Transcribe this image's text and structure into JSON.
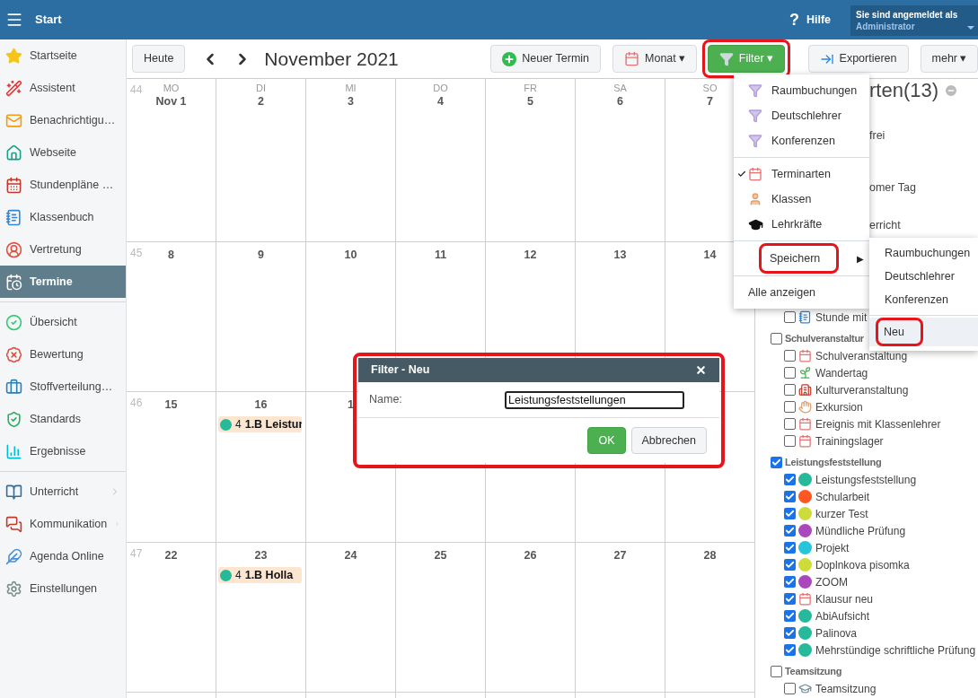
{
  "header": {
    "title": "Start",
    "help_icon": "?",
    "help": "Hilfe",
    "user": {
      "caption": "Sie sind angemeldet als",
      "name": "Administrator"
    }
  },
  "sidebar": {
    "groups": [
      [
        {
          "label": "Startseite",
          "selected": false
        },
        {
          "label": "Assistent",
          "selected": false
        },
        {
          "label": "Benachrichtigu…",
          "selected": false
        },
        {
          "label": "Webseite",
          "selected": false
        },
        {
          "label": "Stundenpläne …",
          "selected": false
        },
        {
          "label": "Klassenbuch",
          "selected": false
        },
        {
          "label": "Vertretung",
          "selected": false
        },
        {
          "label": "Termine",
          "selected": true
        }
      ],
      [
        {
          "label": "Übersicht",
          "selected": false
        },
        {
          "label": "Bewertung",
          "selected": false
        },
        {
          "label": "Stoffverteilung…",
          "selected": false
        },
        {
          "label": "Standards",
          "selected": false
        },
        {
          "label": "Ergebnisse",
          "selected": false
        }
      ],
      [
        {
          "label": "Unterricht",
          "selected": false,
          "has_submenu": true
        },
        {
          "label": "Kommunikation",
          "selected": false,
          "has_submenu": true
        },
        {
          "label": "Agenda Online",
          "selected": false
        },
        {
          "label": "Einstellungen",
          "selected": false
        }
      ]
    ]
  },
  "toolbar": {
    "today": "Heute",
    "title": "November 2021",
    "buttons": [
      {
        "label": "Neuer Termin",
        "kind": "add"
      },
      {
        "label": "Monat",
        "kind": "view",
        "caret": "▾"
      },
      {
        "label": "Filter",
        "kind": "filter",
        "caret": "▾",
        "marked": true
      },
      {
        "label": "Exportieren",
        "kind": "export"
      },
      {
        "label": "mehr",
        "kind": "more",
        "caret": "▾"
      }
    ]
  },
  "calendar": {
    "day_names": [
      "MO",
      "DI",
      "MI",
      "DO",
      "FR",
      "SA",
      "SO"
    ],
    "weeks": [
      {
        "number": "44",
        "days": [
          {
            "date": "Nov 1"
          },
          {
            "date": "2"
          },
          {
            "date": "3"
          },
          {
            "date": "4"
          },
          {
            "date": "5"
          },
          {
            "date": "6"
          },
          {
            "date": "7"
          }
        ]
      },
      {
        "number": "45",
        "days": [
          {
            "date": "8"
          },
          {
            "date": "9"
          },
          {
            "date": "10"
          },
          {
            "date": "11"
          },
          {
            "date": "12"
          },
          {
            "date": "13"
          },
          {
            "date": "14"
          }
        ]
      },
      {
        "number": "46",
        "days": [
          {
            "date": "15"
          },
          {
            "date": "16",
            "events": [
              {
                "count": "4",
                "title": "1.B Leistur"
              }
            ]
          },
          {
            "date": "1"
          }
        ]
      },
      {
        "number": "47",
        "days": [
          {
            "date": "22"
          },
          {
            "date": "23",
            "events": [
              {
                "count": "4",
                "title": "1.B Holla"
              }
            ]
          },
          {
            "date": "24"
          },
          {
            "date": "25"
          },
          {
            "date": "26"
          },
          {
            "date": "27"
          },
          {
            "date": "28"
          }
        ]
      }
    ]
  },
  "filter_panel": {
    "heading": "rten(13)",
    "fragments": [
      "frei",
      "omer Tag",
      "erricht"
    ],
    "tree": [
      {
        "children": [
          {
            "label": "Stunde mit",
            "checked": false
          }
        ]
      },
      {
        "label": "Schulveranstaltur",
        "checked": false,
        "children": [
          {
            "label": "Schulveranstaltung",
            "checked": false
          },
          {
            "label": "Wandertag",
            "checked": false
          },
          {
            "label": "Kulturveranstaltung",
            "checked": false
          },
          {
            "label": "Exkursion",
            "checked": false
          },
          {
            "label": "Ereignis mit Klassenlehrer",
            "checked": false
          },
          {
            "label": "Trainingslager",
            "checked": false
          }
        ]
      },
      {
        "label": "Leistungsfeststellung",
        "checked": true,
        "children": [
          {
            "label": "Leistungsfeststellung",
            "checked": true,
            "color": "#26b99a"
          },
          {
            "label": "Schularbeit",
            "checked": true,
            "color": "#ff5722"
          },
          {
            "label": "kurzer Test",
            "checked": true,
            "color": "#cddc39"
          },
          {
            "label": "Mündliche Prüfung",
            "checked": true,
            "color": "#ab47bc"
          },
          {
            "label": "Projekt",
            "checked": true,
            "color": "#26c6da"
          },
          {
            "label": "Doplnkova pisomka",
            "checked": true,
            "color": "#cddc39"
          },
          {
            "label": "ZOOM",
            "checked": true,
            "color": "#ab47bc"
          },
          {
            "label": "Klausur neu",
            "checked": true
          },
          {
            "label": "AbiAufsicht",
            "checked": true,
            "color": "#26b99a"
          },
          {
            "label": "Palinova",
            "checked": true,
            "color": "#26b99a"
          },
          {
            "label": "Mehrstündige schriftliche Prüfung",
            "checked": true,
            "color": "#26b99a"
          }
        ]
      },
      {
        "label": "Teamsitzung",
        "checked": false,
        "children": [
          {
            "label": "Teamsitzung",
            "checked": false
          }
        ]
      }
    ]
  },
  "filter_menu": {
    "sections": [
      [
        {
          "label": "Raumbuchungen",
          "kind": "saved"
        },
        {
          "label": "Deutschlehrer",
          "kind": "saved"
        },
        {
          "label": "Konferenzen",
          "kind": "saved"
        }
      ],
      [
        {
          "label": "Terminarten",
          "kind": "type",
          "checked": true
        },
        {
          "label": "Klassen",
          "kind": "class",
          "checked": false
        },
        {
          "label": "Lehrkräfte",
          "kind": "teacher",
          "checked": false
        }
      ],
      [
        {
          "label": "Speichern",
          "kind": "submenu",
          "arrow": "▶",
          "marked": true
        }
      ],
      [
        {
          "label": "Alle anzeigen",
          "kind": "plain"
        }
      ]
    ]
  },
  "save_submenu": {
    "sections": [
      [
        {
          "label": "Raumbuchungen",
          "selected": false
        },
        {
          "label": "Deutschlehrer",
          "selected": false
        },
        {
          "label": "Konferenzen",
          "selected": false
        }
      ],
      [
        {
          "label": "Neu",
          "selected": true,
          "marked": true
        }
      ]
    ]
  },
  "dialog": {
    "title": "Filter - Neu",
    "marked": true,
    "fields": [
      {
        "label": "Name:",
        "value": "Leistungsfeststellungen"
      }
    ],
    "buttons": [
      {
        "label": "OK",
        "kind": "primary"
      },
      {
        "label": "Abbrechen",
        "kind": "default"
      }
    ]
  }
}
